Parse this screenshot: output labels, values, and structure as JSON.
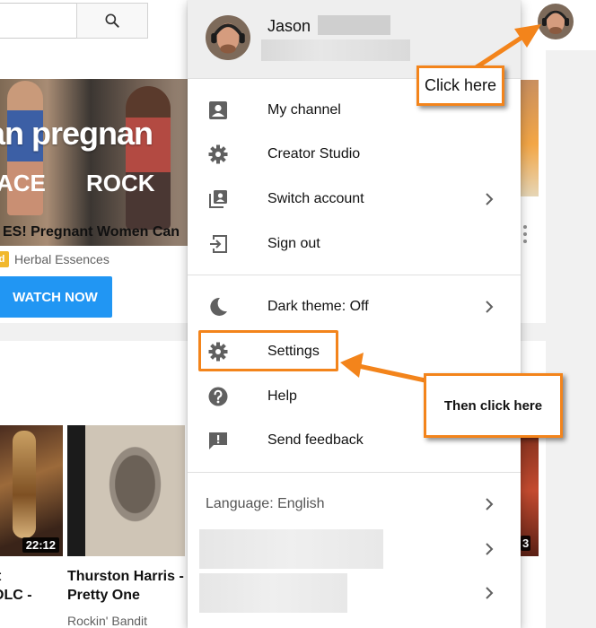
{
  "header": {
    "search_placeholder": "",
    "search_icon": "search-icon",
    "avatar_icon": "avatar-icon"
  },
  "ad": {
    "thumbnail_text_main": "an pregnan",
    "thumbnail_text_left": "ACE",
    "thumbnail_text_right": "ROCK",
    "title": "ES! Pregnant Women Can",
    "badge": "d",
    "channel": "Herbal Essences",
    "cta_label": "WATCH NOW"
  },
  "videos": [
    {
      "duration": "22:12",
      "title_line1": "t",
      "title_line2": "OLC -",
      "channel": ""
    },
    {
      "duration": "",
      "title_line1": "Thurston Harris -",
      "title_line2": "Pretty One",
      "channel": "Rockin' Bandit"
    },
    {
      "duration": "3",
      "title_line1": "",
      "title_line2": "",
      "channel": ""
    }
  ],
  "menu": {
    "user_name": "Jason",
    "items": [
      {
        "label": "My channel",
        "icon": "person-icon",
        "chevron": false
      },
      {
        "label": "Creator Studio",
        "icon": "gear-icon",
        "chevron": false
      },
      {
        "label": "Switch account",
        "icon": "switch-account-icon",
        "chevron": true
      },
      {
        "label": "Sign out",
        "icon": "sign-out-icon",
        "chevron": false
      },
      {
        "label": "Dark theme: Off",
        "icon": "moon-icon",
        "chevron": true
      },
      {
        "label": "Settings",
        "icon": "gear-icon",
        "chevron": false
      },
      {
        "label": "Help",
        "icon": "help-icon",
        "chevron": false
      },
      {
        "label": "Send feedback",
        "icon": "feedback-icon",
        "chevron": false
      }
    ],
    "language_label": "Language: English"
  },
  "annotations": {
    "callout_1": "Click here",
    "callout_2": "Then click here",
    "accent_color": "#f3841b"
  }
}
